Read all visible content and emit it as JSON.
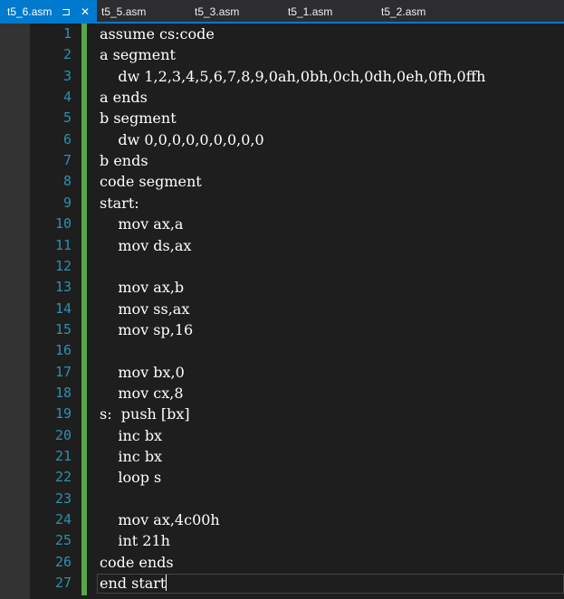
{
  "tabs": [
    {
      "label": "t5_6.asm",
      "active": true,
      "pin_icon": "pin-icon",
      "close_icon": "close-icon"
    },
    {
      "label": "t5_5.asm",
      "active": false
    },
    {
      "label": "t5_3.asm",
      "active": false
    },
    {
      "label": "t5_1.asm",
      "active": false
    },
    {
      "label": "t5_2.asm",
      "active": false
    }
  ],
  "editor": {
    "current_line": 27,
    "lines": [
      {
        "n": "1",
        "text": "assume cs:code"
      },
      {
        "n": "2",
        "text": "a segment"
      },
      {
        "n": "3",
        "text": "    dw 1,2,3,4,5,6,7,8,9,0ah,0bh,0ch,0dh,0eh,0fh,0ffh"
      },
      {
        "n": "4",
        "text": "a ends"
      },
      {
        "n": "5",
        "text": "b segment"
      },
      {
        "n": "6",
        "text": "    dw 0,0,0,0,0,0,0,0,0"
      },
      {
        "n": "7",
        "text": "b ends"
      },
      {
        "n": "8",
        "text": "code segment"
      },
      {
        "n": "9",
        "text": "start:"
      },
      {
        "n": "10",
        "text": "    mov ax,a"
      },
      {
        "n": "11",
        "text": "    mov ds,ax"
      },
      {
        "n": "12",
        "text": ""
      },
      {
        "n": "13",
        "text": "    mov ax,b"
      },
      {
        "n": "14",
        "text": "    mov ss,ax"
      },
      {
        "n": "15",
        "text": "    mov sp,16"
      },
      {
        "n": "16",
        "text": ""
      },
      {
        "n": "17",
        "text": "    mov bx,0"
      },
      {
        "n": "18",
        "text": "    mov cx,8"
      },
      {
        "n": "19",
        "text": "s:  push [bx]"
      },
      {
        "n": "20",
        "text": "    inc bx"
      },
      {
        "n": "21",
        "text": "    inc bx"
      },
      {
        "n": "22",
        "text": "    loop s"
      },
      {
        "n": "23",
        "text": ""
      },
      {
        "n": "24",
        "text": "    mov ax,4c00h"
      },
      {
        "n": "25",
        "text": "    int 21h"
      },
      {
        "n": "26",
        "text": "code ends"
      },
      {
        "n": "27",
        "text": "end start"
      }
    ]
  },
  "colors": {
    "accent": "#007acc",
    "line_number": "#2b91af",
    "change_bar": "#57a64a",
    "background": "#1e1e1e",
    "text": "#ffffff"
  }
}
